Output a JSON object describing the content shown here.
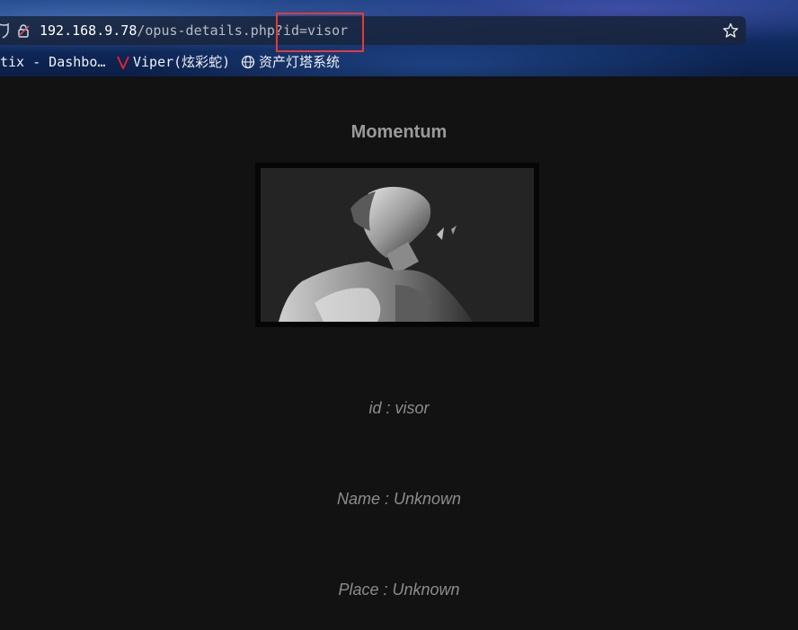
{
  "browser": {
    "url_host": "192.168.9.78",
    "url_path": "/opus-details.php?id=visor",
    "bookmarks": [
      {
        "label": "tix - Dashbo…",
        "icon": "none"
      },
      {
        "label": "Viper(炫彩蛇)",
        "icon": "viper-icon"
      },
      {
        "label": "资产灯塔系统",
        "icon": "globe-icon"
      }
    ],
    "annotation_color": "#e23b3b"
  },
  "page": {
    "title": "Momentum",
    "image_alt": "statue",
    "fields": [
      {
        "text": "id : visor"
      },
      {
        "text": "Name : Unknown"
      },
      {
        "text": "Place : Unknown"
      }
    ]
  },
  "colors": {
    "page_background": "#121212",
    "title": "#9a9a9a",
    "info_text": "#8c8c8c"
  }
}
